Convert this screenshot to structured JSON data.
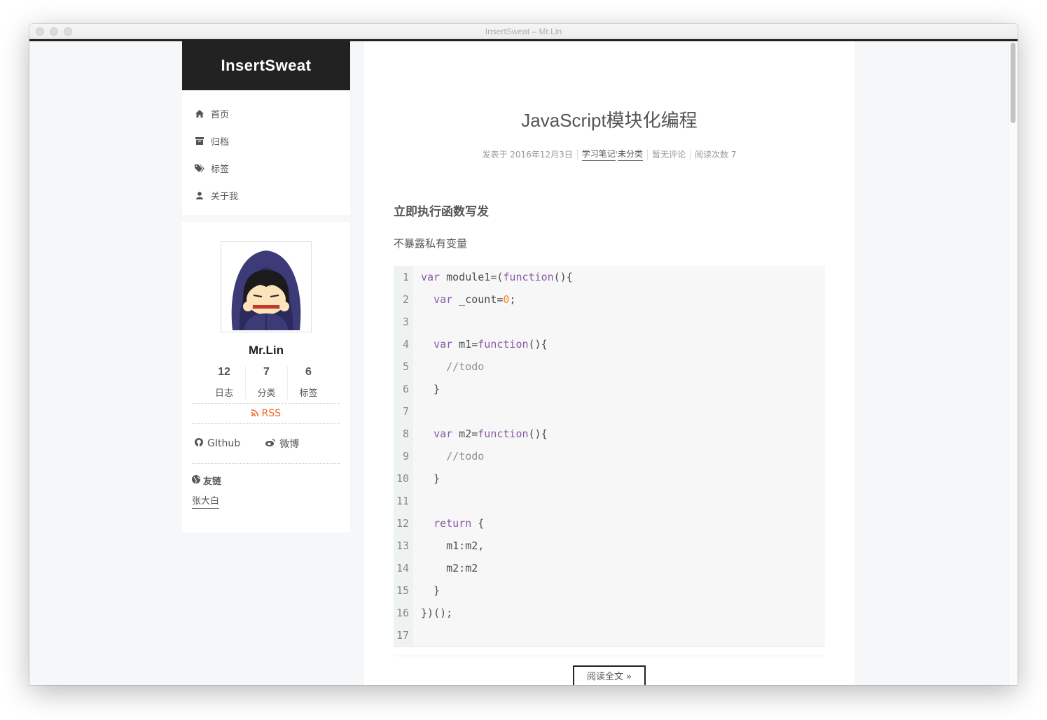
{
  "window": {
    "title": "InsertSweat – Mr.Lin"
  },
  "sidebar": {
    "brand": "InsertSweat",
    "menu": [
      {
        "label": "首页",
        "icon": "home-icon"
      },
      {
        "label": "归档",
        "icon": "archive-icon"
      },
      {
        "label": "标签",
        "icon": "tags-icon"
      },
      {
        "label": "关于我",
        "icon": "user-icon"
      }
    ],
    "author": "Mr.Lin",
    "stats": [
      {
        "num": "12",
        "label": "日志"
      },
      {
        "num": "7",
        "label": "分类"
      },
      {
        "num": "6",
        "label": "标签"
      }
    ],
    "rss": "RSS",
    "social": [
      {
        "label": "GIthub",
        "icon": "github-icon"
      },
      {
        "label": "微博",
        "icon": "weibo-icon"
      }
    ],
    "friends_title": "友链",
    "friends": [
      "张大白"
    ]
  },
  "post": {
    "title": "JavaScript模块化编程",
    "meta": {
      "posted": "发表于 2016年12月3日",
      "category1": "学习笔记",
      "category_sep": "'",
      "category2": "未分类",
      "comments": "暂无评论",
      "views": "阅读次数 7"
    },
    "heading": "立即执行函数写发",
    "paragraph": "不暴露私有变量",
    "code_line_numbers": [
      "1",
      "2",
      "3",
      "4",
      "5",
      "6",
      "7",
      "8",
      "9",
      "10",
      "11",
      "12",
      "13",
      "14",
      "15",
      "16",
      "17"
    ],
    "read_more": "阅读全文 »"
  },
  "colors": {
    "accent_rss": "#fc6423",
    "brand_bg": "#222222",
    "keyword": "#8959a8",
    "number": "#f5871f",
    "comment": "#8e908c"
  }
}
